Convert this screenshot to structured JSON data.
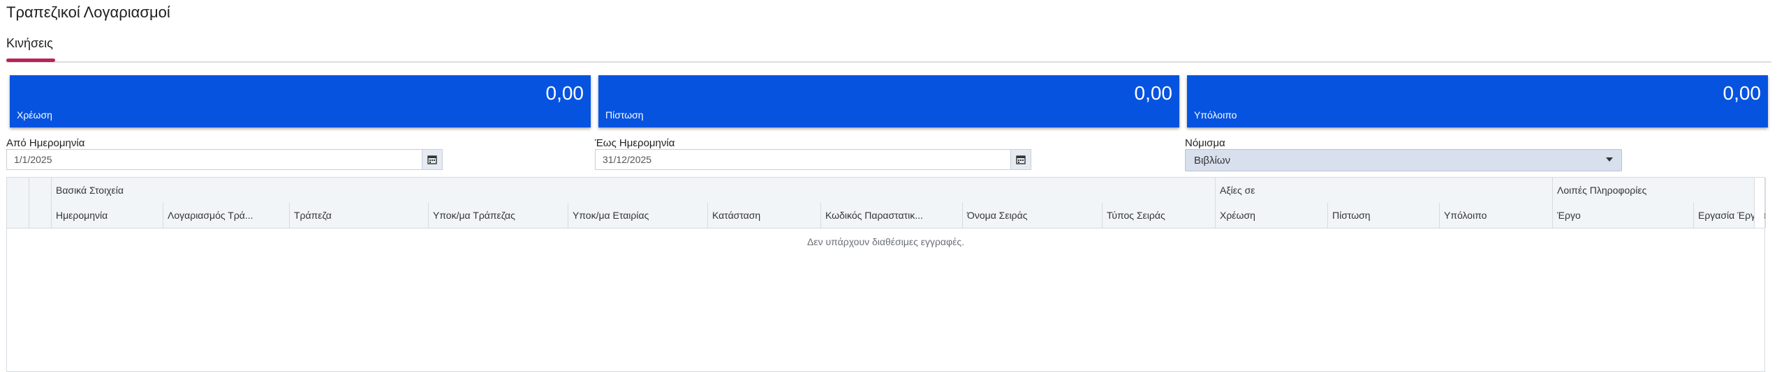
{
  "page": {
    "title": "Τραπεζικοί Λογαριασμοί"
  },
  "tabs": [
    {
      "label": "Κινήσεις",
      "active": true
    }
  ],
  "summary": {
    "debit": {
      "value": "0,00",
      "label": "Χρέωση"
    },
    "credit": {
      "value": "0,00",
      "label": "Πίστωση"
    },
    "balance": {
      "value": "0,00",
      "label": "Υπόλοιπο"
    }
  },
  "filters": {
    "from_date": {
      "label": "Από Ημερομηνία",
      "value": "1/1/2025"
    },
    "to_date": {
      "label": "Έως Ημερομηνία",
      "value": "31/12/2025"
    },
    "currency": {
      "label": "Νόμισμα",
      "value": "Βιβλίων"
    }
  },
  "grid": {
    "groups": {
      "basic": "Βασικά Στοιχεία",
      "values": "Αξίες σε",
      "other": "Λοιπές Πληροφορίες"
    },
    "columns": [
      "Ημερομηνία",
      "Λογαριασμός Τρά...",
      "Τράπεζα",
      "Υποκ/μα Τράπεζας",
      "Υποκ/μα Εταιρίας",
      "Κατάσταση",
      "Κωδικός Παραστατικ...",
      "Όνομα Σειράς",
      "Τύπος Σειράς",
      "Χρέωση",
      "Πίστωση",
      "Υπόλοιπο",
      "Έργο",
      "Εργασία Έργου"
    ],
    "empty_message": "Δεν υπάρχουν διαθέσιμες εγγραφές."
  },
  "colors": {
    "card_bg": "#0653e0",
    "tab_accent": "#b8215a",
    "header_bg": "#f1f5f8"
  },
  "icons": {
    "calendar": "calendar-icon",
    "dropdown": "chevron-down-icon"
  }
}
